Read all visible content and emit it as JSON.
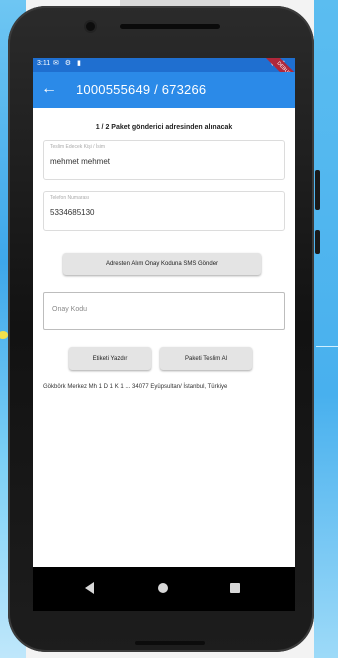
{
  "device": {
    "statusbar": {
      "time": "3:11",
      "icons": "✉ ⚙ ▮"
    },
    "debug_banner": "DEBUG"
  },
  "appbar": {
    "title": "1000555649 / 673266"
  },
  "content": {
    "info_line": "1 / 2 Paket gönderici adresinden alınacak",
    "name_field": {
      "label": "Teslim Edecek Kişi / İsim",
      "value": "mehmet mehmet"
    },
    "phone_field": {
      "label": "Telefon Numarası",
      "value": "5334685130"
    },
    "sms_button": "Adresten Alım Onay Koduna SMS Gönder",
    "otp_field": {
      "placeholder": "Onay Kodu"
    },
    "print_button": "Etiketi Yazdır",
    "deliver_button": "Paketi Teslim Al",
    "address": "Gökbörk Merkez Mh 1 D 1 K 1 ... 34077 Eyüpsultan/ İstanbul, Türkiye"
  },
  "colors": {
    "statusbar": "#1f6fd0",
    "appbar": "#2b8ae8",
    "button_bg": "#e4e4e4"
  },
  "icons": {
    "back": "arrow-left",
    "nav_back": "triangle-left",
    "nav_home": "circle",
    "nav_recents": "square"
  }
}
